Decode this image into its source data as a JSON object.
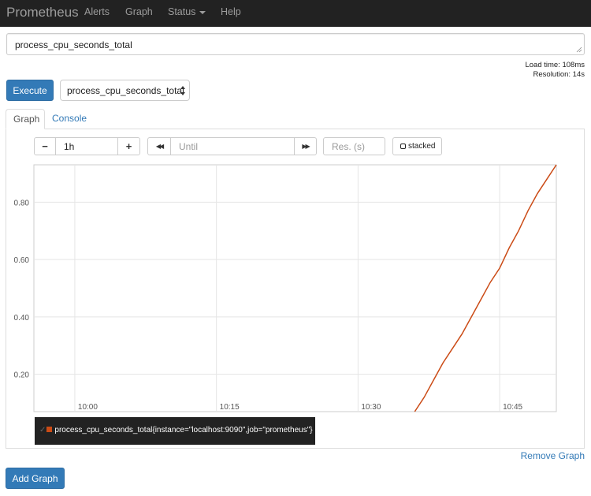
{
  "navbar": {
    "brand": "Prometheus",
    "items": [
      {
        "label": "Alerts"
      },
      {
        "label": "Graph"
      },
      {
        "label": "Status"
      },
      {
        "label": "Help"
      }
    ]
  },
  "query": {
    "expression": "process_cpu_seconds_total",
    "load_time": "Load time: 108ms",
    "resolution": "Resolution: 14s"
  },
  "execute": {
    "label": "Execute",
    "metric_select": "process_cpu_seconds_total"
  },
  "tabs": [
    {
      "label": "Graph",
      "active": true
    },
    {
      "label": "Console",
      "active": false
    }
  ],
  "controls": {
    "range_minus": "−",
    "range_value": "1h",
    "range_plus": "+",
    "back": "◀◀",
    "until_placeholder": "Until",
    "forward": "▶▶",
    "resolution_placeholder": "Res. (s)",
    "stacked_label": "stacked"
  },
  "chart_data": {
    "type": "line",
    "x_ticks": [
      "10:00",
      "10:15",
      "10:30",
      "10:45"
    ],
    "y_ticks": [
      "0.20",
      "0.40",
      "0.60",
      "0.80"
    ],
    "ylim": [
      0.07,
      0.93
    ],
    "grid": true,
    "series": [
      {
        "name": "process_cpu_seconds_total{instance=\"localhost:9090\",job=\"prometheus\"}",
        "color": "#cb4b16",
        "points": [
          [
            "10:36:00",
            0.07
          ],
          [
            "10:37:00",
            0.12
          ],
          [
            "10:38:00",
            0.18
          ],
          [
            "10:39:00",
            0.24
          ],
          [
            "10:40:00",
            0.29
          ],
          [
            "10:41:00",
            0.34
          ],
          [
            "10:42:00",
            0.4
          ],
          [
            "10:43:00",
            0.46
          ],
          [
            "10:44:00",
            0.52
          ],
          [
            "10:45:00",
            0.57
          ],
          [
            "10:46:00",
            0.64
          ],
          [
            "10:47:00",
            0.7
          ],
          [
            "10:48:00",
            0.77
          ],
          [
            "10:49:00",
            0.83
          ],
          [
            "10:50:00",
            0.88
          ],
          [
            "10:51:00",
            0.93
          ]
        ]
      }
    ],
    "legend_placement": "bottom-left"
  },
  "footer": {
    "remove_graph": "Remove Graph",
    "add_graph": "Add Graph"
  }
}
